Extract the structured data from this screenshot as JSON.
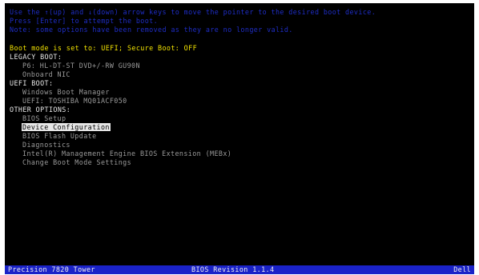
{
  "instructions": [
    "Use the ↑(up) and ↓(down) arrow keys to move the pointer to the desired boot device.",
    "Press [Enter] to attempt the boot.",
    "Note: some options have been removed as they are no longer valid."
  ],
  "boot_mode_line": "Boot mode is set to: UEFI; Secure Boot: OFF",
  "legacy_boot": {
    "heading": "LEGACY BOOT:",
    "items": [
      "P6: HL-DT-ST DVD+/-RW GU90N",
      "Onboard NIC"
    ]
  },
  "uefi_boot": {
    "heading": "UEFI BOOT:",
    "items": [
      "Windows Boot Manager",
      "UEFI: TOSHIBA MQ01ACF050"
    ]
  },
  "other_options": {
    "heading": "OTHER OPTIONS:",
    "items": [
      "BIOS Setup",
      "Device Configuration",
      "BIOS Flash Update",
      "Diagnostics",
      "Intel(R) Management Engine BIOS Extension (MEBx)",
      "Change Boot Mode Settings"
    ],
    "selected": "Device Configuration"
  },
  "footer": {
    "model": "Precision 7820 Tower",
    "bios_revision": "BIOS Revision 1.1.4",
    "vendor": "Dell"
  },
  "colors": {
    "background": "#000000",
    "instruction_text": "#1f2ec8",
    "boot_mode_text": "#f4e400",
    "menu_text": "#e8e8e8",
    "footer_bar": "#1a22c8"
  }
}
